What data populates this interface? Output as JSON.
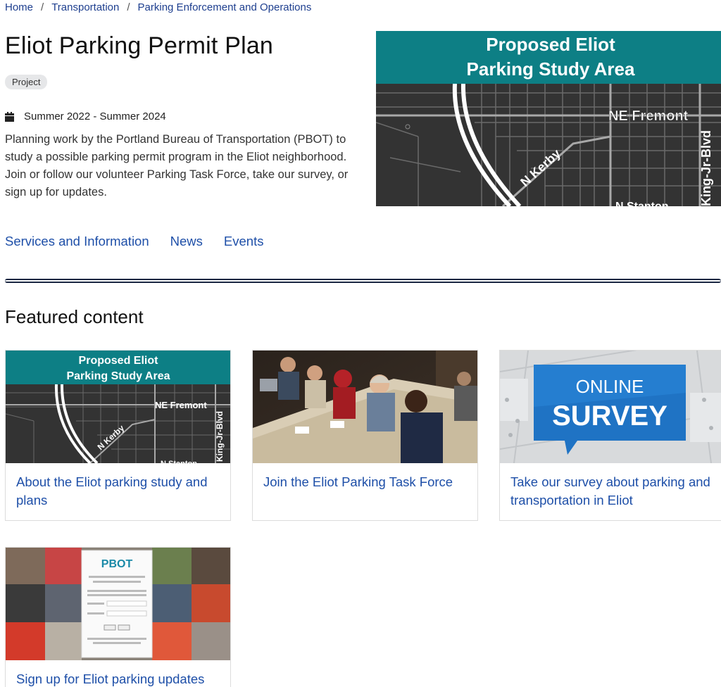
{
  "breadcrumb": {
    "items": [
      "Home",
      "Transportation",
      "Parking Enforcement and Operations"
    ],
    "separator": "/"
  },
  "page": {
    "title": "Eliot Parking Permit Plan",
    "badge": "Project",
    "date_range": "Summer 2022 - Summer 2024",
    "summary": "Planning work by the Portland Bureau of Transportation (PBOT) to study a possible parking permit program in the Eliot neighborhood. Join or follow our volunteer Parking Task Force, take our survey, or sign up for updates."
  },
  "hero_map": {
    "title_line1": "Proposed Eliot",
    "title_line2": "Parking Study Area",
    "street_fremont": "NE Fremont",
    "street_kerby": "N Kerby",
    "street_king": "King-Jr-Blvd",
    "street_stanton": "N Stanton"
  },
  "subnav": {
    "items": [
      "Services and Information",
      "News",
      "Events"
    ]
  },
  "featured": {
    "title": "Featured content",
    "cards": [
      {
        "label": "About the Eliot parking study and plans"
      },
      {
        "label": "Join the Eliot Parking Task Force"
      },
      {
        "label": "Take our survey about parking and transportation in Eliot"
      },
      {
        "label": "Sign up for Eliot parking updates"
      }
    ],
    "survey_image": {
      "line1": "ONLINE",
      "line2": "SURVEY"
    },
    "signup_image": {
      "logo": "PBOT"
    }
  },
  "colors": {
    "link": "#1e4fa8",
    "map_header": "#0d7f85",
    "map_bg": "#3a3a3a",
    "survey_blue": "#1f73c4"
  }
}
